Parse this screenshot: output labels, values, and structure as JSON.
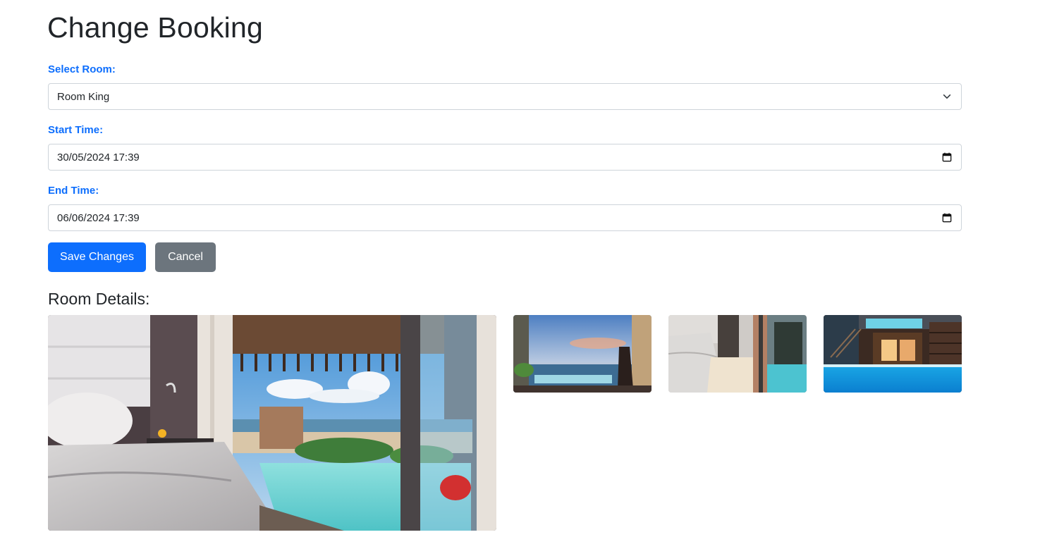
{
  "page": {
    "title": "Change Booking",
    "room_details_heading": "Room Details:"
  },
  "form": {
    "room": {
      "label": "Select Room:",
      "value": "Room King",
      "icon": "chevron-down-icon"
    },
    "start": {
      "label": "Start Time:",
      "value": "30/05/2024 17:39",
      "icon": "calendar-icon"
    },
    "end": {
      "label": "End Time:",
      "value": "06/06/2024 17:39",
      "icon": "calendar-icon"
    }
  },
  "buttons": {
    "save": "Save Changes",
    "cancel": "Cancel"
  },
  "colors": {
    "primary": "#0d6efd",
    "secondary": "#6c757d",
    "label": "#0d6efd"
  },
  "gallery": {
    "images": [
      "main-room-photo",
      "sea-view-photo",
      "bedroom-pool-photo",
      "night-pool-photo"
    ]
  }
}
